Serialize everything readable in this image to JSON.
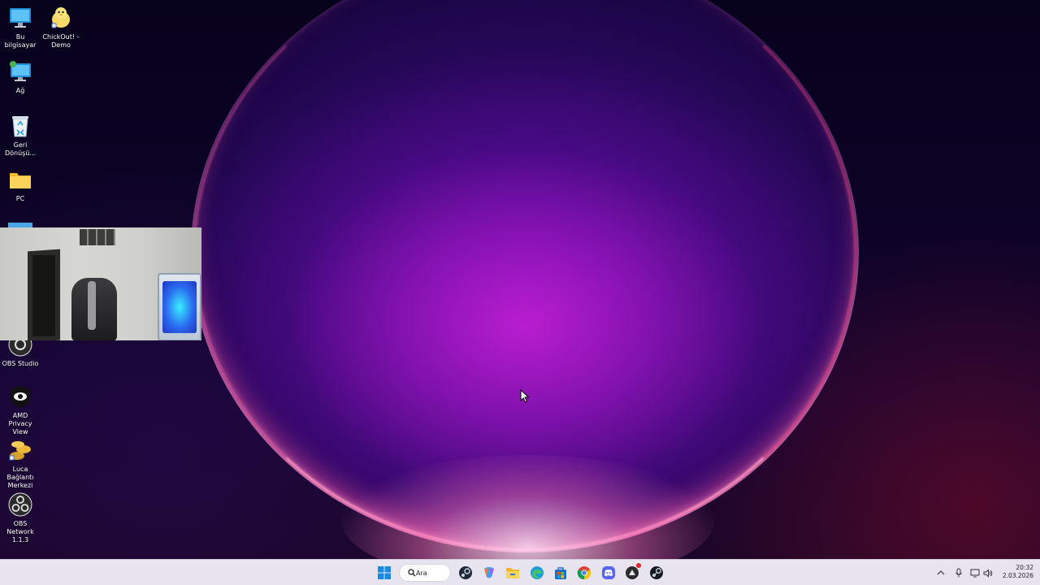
{
  "desktop": {
    "icons": [
      {
        "label": "Bu bilgisayar",
        "icon": "monitor-icon"
      },
      {
        "label": "ChickOut! - Demo",
        "icon": "chick-icon"
      },
      {
        "label": "Ağ",
        "icon": "network-monitor-icon"
      },
      {
        "label": "Geri Dönüşü...",
        "icon": "recycle-bin-icon"
      },
      {
        "label": "PC",
        "icon": "folder-icon"
      },
      {
        "label": "OBS Studio",
        "icon": "obs-icon"
      },
      {
        "label": "AMD Privacy View",
        "icon": "eye-shield-icon"
      },
      {
        "label": "Luca Bağlantı Merkezi",
        "icon": "coins-icon"
      },
      {
        "label": "OBS Network 1.1.3",
        "icon": "obs-network-icon"
      }
    ]
  },
  "taskbar": {
    "search_label": "Ara",
    "apps": [
      "start-icon",
      "search-icon",
      "steam-alt-icon",
      "copilot-icon",
      "file-explorer-icon",
      "edge-icon",
      "store-icon",
      "chrome-icon",
      "discord-icon",
      "riot-icon",
      "steam-icon"
    ],
    "tray": [
      "chevron-up-icon",
      "microphone-icon",
      "display-icon",
      "volume-icon"
    ],
    "clock": {
      "time": "20:32",
      "date": "2.03.2026"
    }
  },
  "colors": {
    "taskbar_bg": "#e8e4ef",
    "wallpaper_accent": "#b020c8"
  }
}
